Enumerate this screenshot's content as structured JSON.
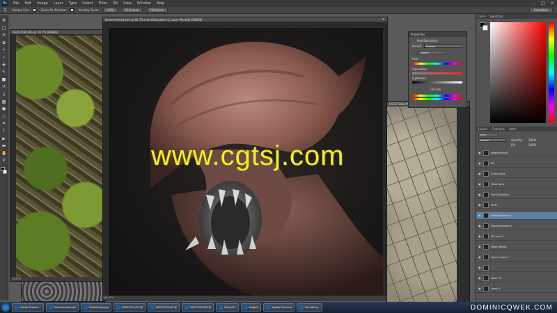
{
  "app": {
    "logo": "Ps",
    "menu": [
      "File",
      "Edit",
      "Image",
      "Layer",
      "Type",
      "Select",
      "Filter",
      "3D",
      "View",
      "Window",
      "Help"
    ],
    "window_controls": [
      "minimize-icon",
      "maximize-icon",
      "close-icon"
    ]
  },
  "options_bar": {
    "sample_size_label": "Sample Size",
    "zoom_all_label": "Zoom All Windows",
    "scrubby_label": "Scrubby Zoom",
    "btn_100": "100%",
    "btn_fit": "Fit Screen",
    "btn_fill": "Fill Screen",
    "workspace": "Essentials"
  },
  "tools": [
    "move-icon",
    "marquee-icon",
    "lasso-icon",
    "quick-select-icon",
    "crop-icon",
    "eyedropper-icon",
    "healing-icon",
    "brush-icon",
    "stamp-icon",
    "history-brush-icon",
    "eraser-icon",
    "gradient-icon",
    "blur-icon",
    "dodge-icon",
    "pen-icon",
    "type-icon",
    "path-select-icon",
    "shape-icon",
    "hand-icon",
    "zoom-icon"
  ],
  "documents": {
    "moss": {
      "title": "DSC07194.JPG @ 16.7% (RGB/8)",
      "status": "16.67%"
    },
    "main": {
      "title": "Hammerhead.psd @ 66.7% (Hue/Saturation 5, Layer Mask/8) (RGB/8)",
      "status": "66.67%"
    },
    "stone": {
      "title": "DSC07182.JPG",
      "status": ""
    }
  },
  "properties": {
    "title": "Properties",
    "subtitle": "Hue/Saturation",
    "preset_label": "Preset:",
    "preset_value": "Custom",
    "channel_value": "Master",
    "hue_label": "Hue:",
    "sat_label": "Saturation:",
    "light_label": "Lightness:",
    "colorize_label": "Colorize"
  },
  "color_panel": {
    "tab_color": "Color",
    "tab_swatches": "Swatches"
  },
  "layers_panel": {
    "tabs": [
      "Layers",
      "Channels",
      "Paths"
    ],
    "kind_filter": "Kind",
    "blend_mode": "Normal",
    "opacity_label": "Opacity:",
    "opacity_value": "100%",
    "fill_label": "Fill:",
    "fill_value": "100%",
    "layers": [
      {
        "name": "Hammerhead",
        "selected": false
      },
      {
        "name": "BG",
        "selected": false
      },
      {
        "name": "Gums mask",
        "selected": false
      },
      {
        "name": "Head Light",
        "selected": false
      },
      {
        "name": "Hue Saturation",
        "selected": false
      },
      {
        "name": "Teeth",
        "selected": false
      },
      {
        "name": "Hue/Saturation 5",
        "selected": true
      },
      {
        "name": "Hue/Saturation 4",
        "selected": false
      },
      {
        "name": "BG copy 2",
        "selected": false
      },
      {
        "name": "Head Diffuse",
        "selected": false
      },
      {
        "name": "Layer 1 copy 2",
        "selected": false
      },
      {
        "name": "",
        "selected": false
      },
      {
        "name": "Layer 10",
        "selected": false
      },
      {
        "name": "Layer 4",
        "selected": false
      }
    ]
  },
  "taskbar": {
    "items": [
      "Adobe Photosh...",
      "Hammerhead.psd",
      "TeethDesign.jpg",
      "DSC07194.JPG @",
      "DSC07182.JPG @",
      "DSC07196.JPG @",
      "Work (D:)",
      "Organic",
      "Spotify Premium",
      "Recording..."
    ]
  },
  "watermarks": {
    "url": "www.cgtsj.com",
    "brand": "DOMINICQWEK.COM"
  },
  "colors": {
    "watermark_yellow": "#f4ef1a",
    "selection_blue": "#5d7fa8",
    "panel_gray": "#535353"
  }
}
